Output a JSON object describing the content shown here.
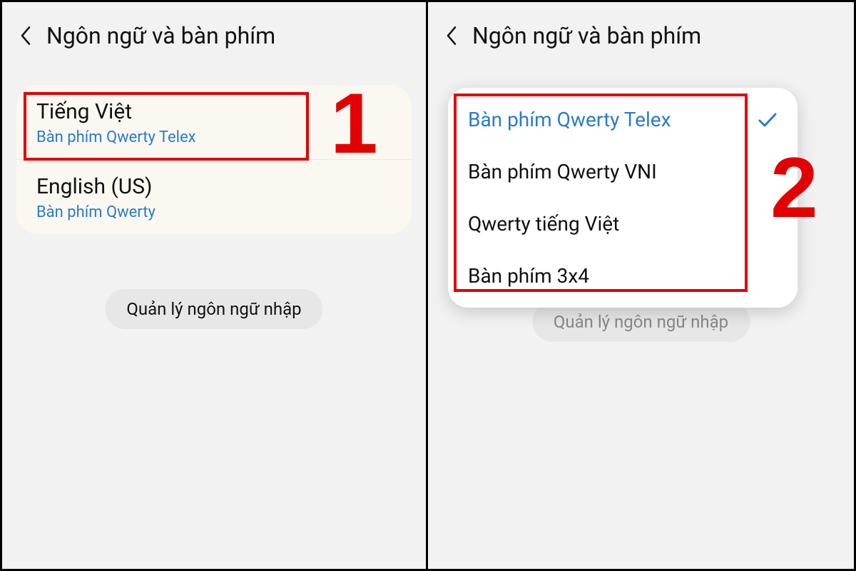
{
  "left": {
    "header": {
      "title": "Ngôn ngữ và bàn phím"
    },
    "languages": [
      {
        "name": "Tiếng Việt",
        "layout": "Bàn phím Qwerty Telex"
      },
      {
        "name": "English (US)",
        "layout": "Bàn phím Qwerty"
      }
    ],
    "manage_button": "Quản lý ngôn ngữ nhập",
    "step": "1"
  },
  "right": {
    "header": {
      "title": "Ngôn ngữ và bàn phím"
    },
    "popup": {
      "options": [
        {
          "label": "Bàn phím Qwerty Telex",
          "selected": true
        },
        {
          "label": "Bàn phím Qwerty VNI",
          "selected": false
        },
        {
          "label": "Qwerty tiếng Việt",
          "selected": false
        },
        {
          "label": "Bàn phím 3x4",
          "selected": false
        }
      ]
    },
    "manage_button": "Quản lý ngôn ngữ nhập",
    "step": "2"
  },
  "colors": {
    "accent_link": "#2a7cc7",
    "highlight": "#e30000",
    "card_bg": "#fbf8f1",
    "page_bg": "#f2f2f2"
  }
}
